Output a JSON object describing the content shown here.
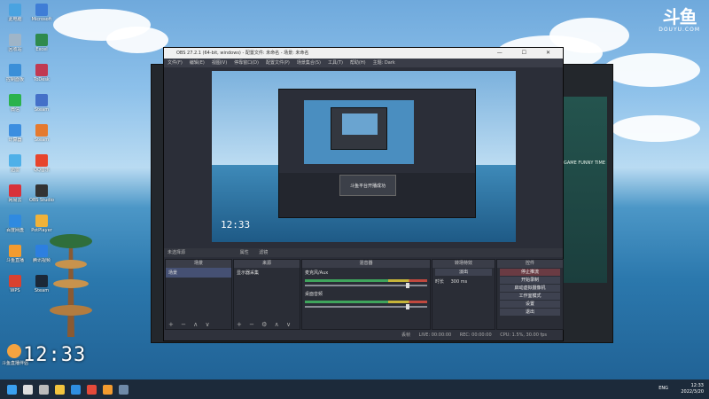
{
  "watermark": {
    "logo": "斗鱼",
    "sub": "DOUYU.COM"
  },
  "desktop": {
    "icons": [
      {
        "label": "此电脑",
        "color": "#4aa3e0"
      },
      {
        "label": "Microsoft",
        "color": "#3f7dd6"
      },
      {
        "label": "回收站",
        "color": "#9fb5c8"
      },
      {
        "label": "Excel",
        "color": "#2f8a4d"
      },
      {
        "label": "控制面板",
        "color": "#3b8fd8"
      },
      {
        "label": "ToDesk",
        "color": "#c13a53"
      },
      {
        "label": "微信",
        "color": "#2bb24c"
      },
      {
        "label": "Steam",
        "color": "#4470c8"
      },
      {
        "label": "计算器",
        "color": "#3c8ee0"
      },
      {
        "label": "Steam",
        "color": "#e57a2f"
      },
      {
        "label": "迅雷",
        "color": "#4fb0e8"
      },
      {
        "label": "QQ音乐",
        "color": "#e7452d"
      },
      {
        "label": "网易云",
        "color": "#d8323a"
      },
      {
        "label": "OBS Studio",
        "color": "#333333"
      },
      {
        "label": "百度网盘",
        "color": "#2f8ae0"
      },
      {
        "label": "PotPlayer",
        "color": "#f0b23a"
      },
      {
        "label": "斗鱼直播",
        "color": "#f39b2f"
      },
      {
        "label": "腾讯视频",
        "color": "#2d7fe0"
      },
      {
        "label": "WPS",
        "color": "#d8412f"
      },
      {
        "label": "Steam",
        "color": "#1b2838"
      }
    ],
    "clock_icon_label": "斗鱼直播伴侣",
    "clock": "12:33"
  },
  "bg_window": {
    "ad_text": "GAME FUNNY TIME"
  },
  "obs": {
    "title": "OBS 27.2.1 (64-bit, windows) - 配置文件: 未命名 - 场景: 未命名",
    "window_controls": "— ☐ ✕",
    "menu": [
      "文件(F)",
      "编辑(E)",
      "视图(V)",
      "停靠窗口(D)",
      "配置文件(P)",
      "场景集合(S)",
      "工具(T)",
      "帮助(H)",
      "主题: Dark"
    ],
    "preview": {
      "clock": "12:33",
      "popup": "斗鱼平台开播成功"
    },
    "docks_header": "未选择源",
    "docks_header_buttons": [
      "属性",
      "滤镜"
    ],
    "scenes": {
      "title": "场景",
      "items": [
        "场景"
      ],
      "footer": "+ − ∧ ∨"
    },
    "sources": {
      "title": "来源",
      "items": [
        "显示器采集"
      ],
      "footer": "+ − ⚙ ∧ ∨"
    },
    "mixer": {
      "title": "混音器",
      "channels": [
        {
          "name": "麦克风/Aux",
          "db": "0.0 dB"
        },
        {
          "name": "桌面音频",
          "db": "0.0 dB"
        }
      ]
    },
    "transitions": {
      "title": "转场特效",
      "type": "淡出",
      "duration_label": "时长",
      "duration": "300 ms"
    },
    "controls": {
      "title": "控件",
      "buttons": [
        "停止推流",
        "开始录制",
        "启动虚拟摄像机",
        "工作室模式",
        "设置",
        "退出"
      ]
    },
    "status": {
      "live": "LIVE: 00:00:00",
      "rec": "REC: 00:00:00",
      "cpu": "CPU: 1.5%, 30.00 fps",
      "dropped": "丢帧"
    }
  },
  "taskbar": {
    "icons": [
      {
        "name": "windows-start-icon",
        "color": "#3aa0f0"
      },
      {
        "name": "search-icon",
        "color": "#dddddd"
      },
      {
        "name": "task-view-icon",
        "color": "#bbbbbb"
      },
      {
        "name": "explorer-icon",
        "color": "#f3c43e"
      },
      {
        "name": "edge-icon",
        "color": "#2f8ee0"
      },
      {
        "name": "chrome-icon",
        "color": "#e34a3a"
      },
      {
        "name": "douyu-icon",
        "color": "#f39b2f"
      },
      {
        "name": "steam-icon",
        "color": "#6f8aa8"
      }
    ],
    "lang": "ENG",
    "time": "12:33",
    "date": "2022/3/20"
  }
}
